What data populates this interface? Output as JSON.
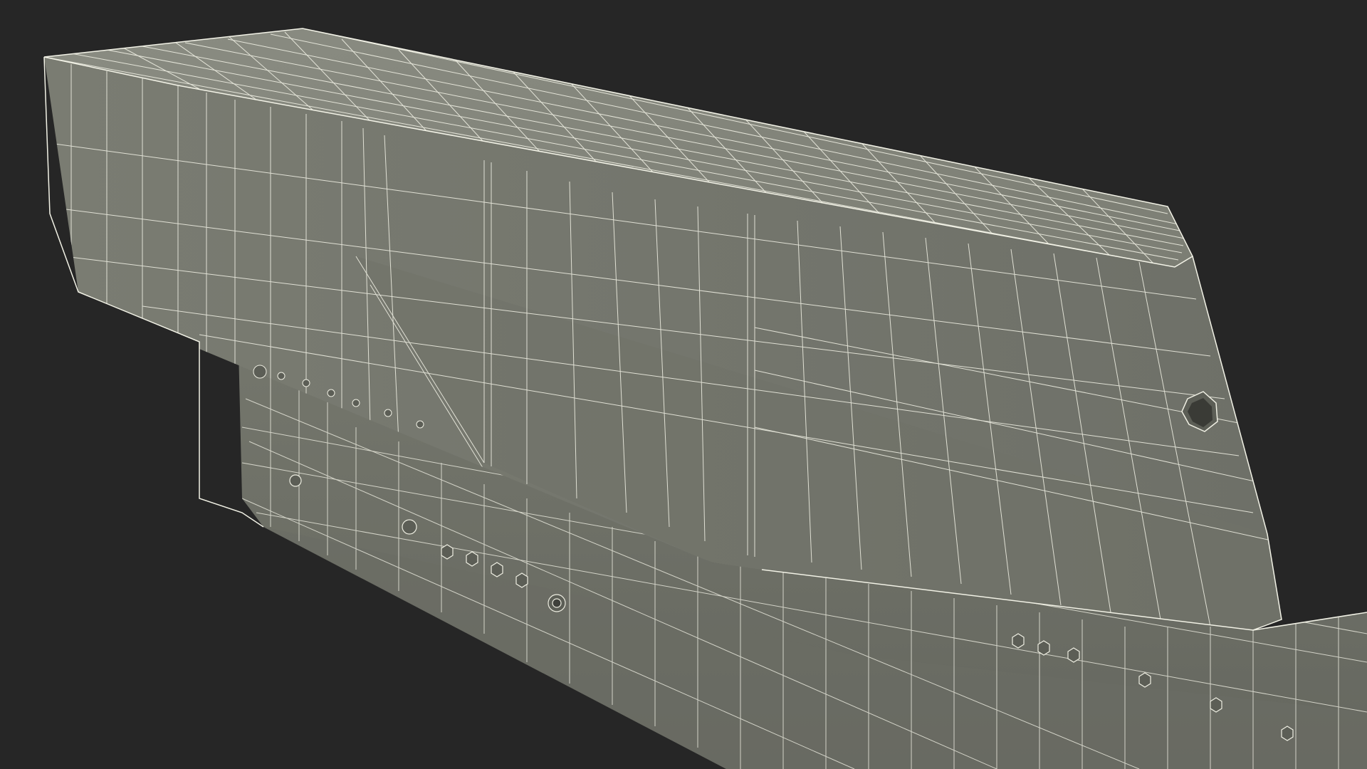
{
  "scene": {
    "background_color": "#262626",
    "surface_color": "#787a70",
    "surface_top_color": "#82847a",
    "surface_shadow_color": "#6a6c63",
    "wire_color": "#e8e8dc",
    "hole_color": "#3a3b36",
    "subject": "wireframe-mesh-render"
  }
}
